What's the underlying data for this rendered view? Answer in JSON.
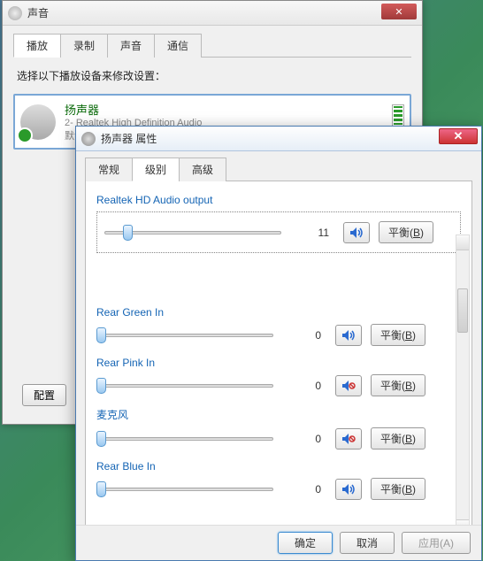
{
  "sound_window": {
    "title": "声音",
    "tabs": [
      "播放",
      "录制",
      "声音",
      "通信"
    ],
    "active_tab_index": 0,
    "instruction": "选择以下播放设备来修改设置：",
    "device": {
      "name": "扬声器",
      "subtitle": "2- Realtek High Definition Audio",
      "status": "默认设备"
    },
    "config_button": "配置"
  },
  "props_window": {
    "title": "扬声器 属性",
    "tabs": [
      "常规",
      "级别",
      "高级"
    ],
    "active_tab_index": 1,
    "balance_label": "平衡",
    "balance_hotkey": "B",
    "channels": [
      {
        "label": "Realtek HD Audio output",
        "value": 11,
        "slider_pct": 11,
        "muted": false,
        "boxed": true
      },
      {
        "label": "Rear Green In",
        "value": 0,
        "slider_pct": 0,
        "muted": false,
        "boxed": false
      },
      {
        "label": "Rear Pink In",
        "value": 0,
        "slider_pct": 0,
        "muted": true,
        "boxed": false
      },
      {
        "label": "麦克风",
        "value": 0,
        "slider_pct": 0,
        "muted": true,
        "boxed": false
      },
      {
        "label": "Rear Blue In",
        "value": 0,
        "slider_pct": 0,
        "muted": false,
        "boxed": false
      }
    ],
    "footer": {
      "ok": "确定",
      "cancel": "取消",
      "apply": "应用",
      "apply_hotkey": "A"
    }
  }
}
